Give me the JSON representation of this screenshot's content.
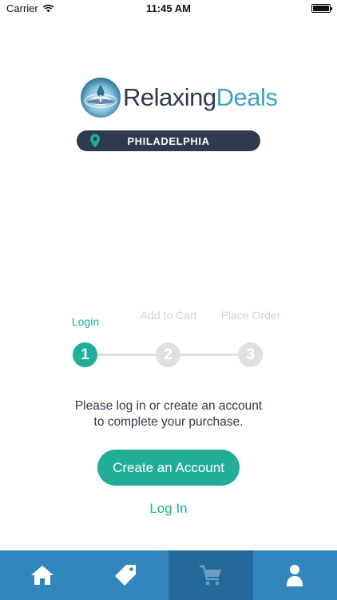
{
  "status_bar": {
    "carrier": "Carrier",
    "time": "11:45 AM"
  },
  "brand": {
    "name_part1": "Relaxing",
    "name_part2": "Deals"
  },
  "location": {
    "city": "PHILADELPHIA",
    "icon": "location-pin-icon"
  },
  "steps": [
    {
      "label": "Login",
      "number": "1",
      "state": "active"
    },
    {
      "label": "Add to Cart",
      "number": "2",
      "state": "inactive"
    },
    {
      "label": "Place Order",
      "number": "3",
      "state": "inactive"
    }
  ],
  "message": {
    "line1": "Please log in or create an account",
    "line2": "to complete your purchase."
  },
  "actions": {
    "create_account": "Create an Account",
    "log_in": "Log In"
  },
  "tab_bar": {
    "items": [
      {
        "icon": "home-icon",
        "selected": false
      },
      {
        "icon": "tag-icon",
        "selected": false
      },
      {
        "icon": "cart-icon",
        "selected": true
      },
      {
        "icon": "user-icon",
        "selected": false
      }
    ]
  },
  "colors": {
    "accent": "#1fae97",
    "tab_bar": "#3186bd",
    "tab_selected": "#236a9b",
    "pill": "#2d3b4c"
  }
}
